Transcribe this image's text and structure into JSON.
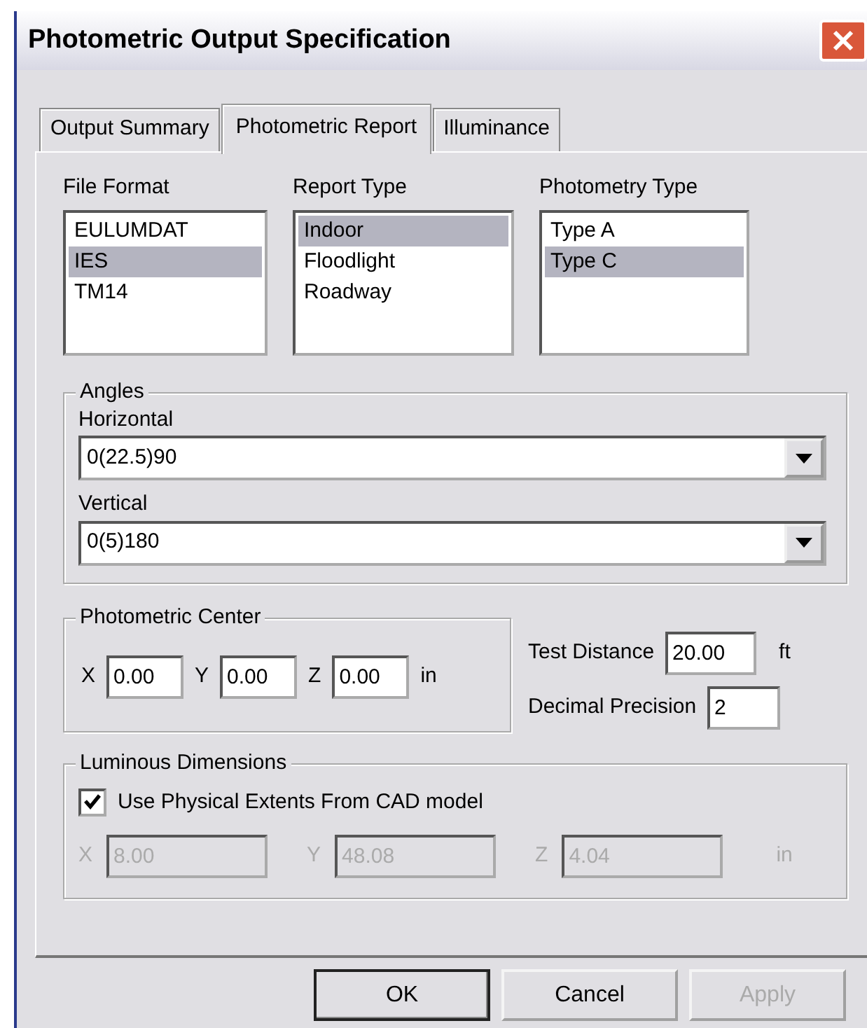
{
  "window": {
    "title": "Photometric Output Specification"
  },
  "tabs": [
    {
      "label": "Output Summary",
      "selected": false
    },
    {
      "label": "Photometric Report",
      "selected": true
    },
    {
      "label": "Illuminance",
      "selected": false
    }
  ],
  "lists": [
    {
      "label": "File Format",
      "items": [
        {
          "label": "EULUMDAT",
          "selected": false
        },
        {
          "label": "IES",
          "selected": true
        },
        {
          "label": "TM14",
          "selected": false
        }
      ]
    },
    {
      "label": "Report Type",
      "items": [
        {
          "label": "Indoor",
          "selected": true
        },
        {
          "label": "Floodlight",
          "selected": false
        },
        {
          "label": "Roadway",
          "selected": false
        }
      ]
    },
    {
      "label": "Photometry Type",
      "items": [
        {
          "label": "Type A",
          "selected": false
        },
        {
          "label": "Type C",
          "selected": true
        }
      ]
    }
  ],
  "angles": {
    "title": "Angles",
    "fields": [
      {
        "label": "Horizontal",
        "value": "0(22.5)90"
      },
      {
        "label": "Vertical",
        "value": "0(5)180"
      }
    ]
  },
  "photometric_center": {
    "title": "Photometric Center",
    "fields": [
      {
        "label": "X",
        "value": "0.00"
      },
      {
        "label": "Y",
        "value": "0.00"
      },
      {
        "label": "Z",
        "value": "0.00"
      }
    ],
    "unit": "in"
  },
  "test_distance": {
    "label": "Test Distance",
    "value": "20.00",
    "unit": "ft"
  },
  "decimal_precision": {
    "label": "Decimal Precision",
    "value": "2"
  },
  "luminous_dimensions": {
    "title": "Luminous Dimensions",
    "checkbox": {
      "label": "Use Physical Extents From CAD model",
      "checked": true
    },
    "fields": [
      {
        "label": "X",
        "value": "8.00",
        "disabled": true
      },
      {
        "label": "Y",
        "value": "48.08",
        "disabled": true
      },
      {
        "label": "Z",
        "value": "4.04",
        "disabled": true
      }
    ],
    "unit": "in"
  },
  "buttons": [
    {
      "label": "OK",
      "default": true,
      "disabled": false
    },
    {
      "label": "Cancel",
      "default": false,
      "disabled": false
    },
    {
      "label": "Apply",
      "default": false,
      "disabled": true
    }
  ]
}
